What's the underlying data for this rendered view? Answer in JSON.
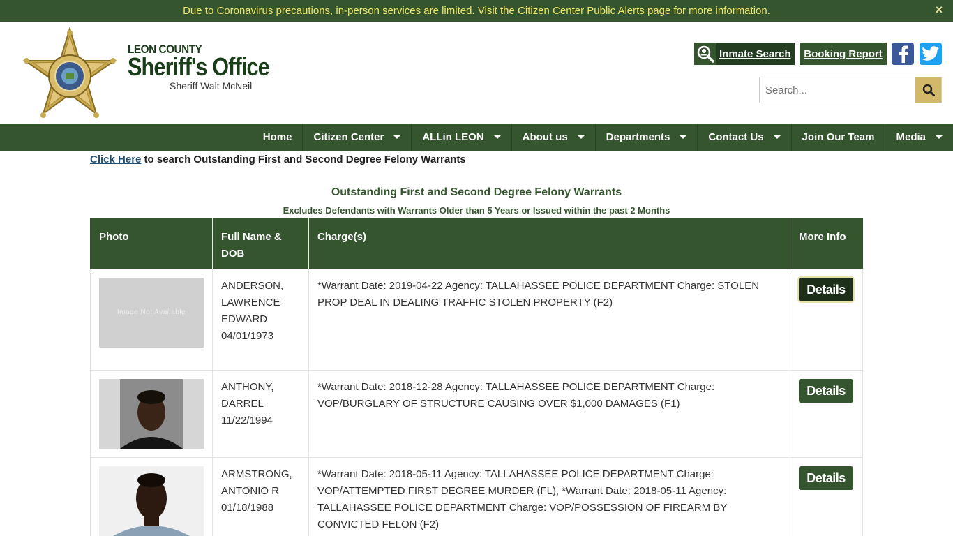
{
  "alert": {
    "text_before": "Due to Coronavirus precautions, in-person services are limited. Visit the ",
    "link_text": "Citizen Center Public Alerts page",
    "text_after": " for more information.",
    "close_icon": "×"
  },
  "brand": {
    "county": "LEON COUNTY",
    "office": "Sheriff's Office",
    "sheriff": "Sheriff Walt McNeil"
  },
  "header": {
    "inmate_search_label": "Inmate Search",
    "booking_report_label": "Booking Report",
    "search_placeholder": "Search..."
  },
  "nav": {
    "items": [
      {
        "label": "Home",
        "dropdown": false
      },
      {
        "label": "Citizen Center",
        "dropdown": true
      },
      {
        "label": "ALLin LEON",
        "dropdown": true
      },
      {
        "label": "About us",
        "dropdown": true
      },
      {
        "label": "Departments",
        "dropdown": true
      },
      {
        "label": "Contact Us",
        "dropdown": true
      },
      {
        "label": "Join Our Team",
        "dropdown": false
      },
      {
        "label": "Media",
        "dropdown": true
      }
    ]
  },
  "content": {
    "click_here": "Click Here",
    "link_rest": " to search Outstanding First and Second Degree Felony Warrants",
    "title": "Outstanding First and Second Degree Felony Warrants",
    "subtitle": "Excludes Defendants with Warrants Older than 5 Years or Issued within the past 2 Months"
  },
  "table": {
    "headers": [
      "Photo",
      "Full Name & DOB",
      "Charge(s)",
      "More Info"
    ],
    "rows": [
      {
        "name_lines": [
          "ANDERSON,",
          "LAWRENCE",
          "EDWARD",
          "04/01/1973"
        ],
        "charges": "*Warrant Date: 2019-04-22 Agency: TALLAHASSEE POLICE DEPARTMENT Charge: STOLEN PROP DEAL IN DEALING TRAFFIC STOLEN PROPERTY (F2)",
        "photo_text": "Image Not Available",
        "details": "Details"
      },
      {
        "name_lines": [
          "ANTHONY,",
          "DARREL",
          "11/22/1994"
        ],
        "charges": "*Warrant Date: 2018-12-28 Agency: TALLAHASSEE POLICE DEPARTMENT Charge: VOP/BURGLARY OF STRUCTURE CAUSING OVER $1,000 DAMAGES (F1)",
        "photo_text": "",
        "details": "Details"
      },
      {
        "name_lines": [
          "ARMSTRONG,",
          "ANTONIO R",
          "01/18/1988"
        ],
        "charges": "*Warrant Date: 2018-05-11 Agency: TALLAHASSEE POLICE DEPARTMENT Charge: VOP/ATTEMPTED FIRST DEGREE MURDER (FL), *Warrant Date: 2018-05-11 Agency: TALLAHASSEE POLICE DEPARTMENT Charge: VOP/POSSESSION OF FIREARM BY CONVICTED FELON (F2)",
        "photo_text": "",
        "details": "Details"
      }
    ]
  }
}
